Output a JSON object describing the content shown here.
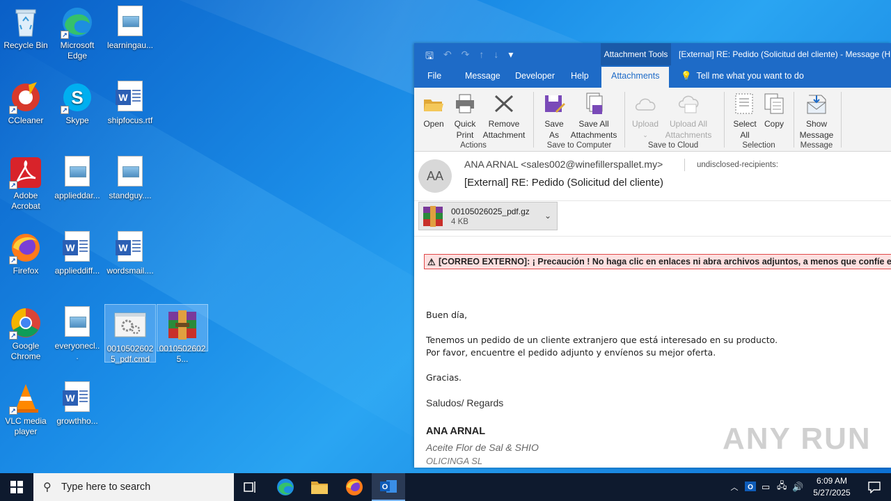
{
  "desktop": {
    "icons": [
      {
        "label": "Recycle Bin"
      },
      {
        "label": "Microsoft Edge"
      },
      {
        "label": "learningau..."
      },
      {
        "label": "CCleaner"
      },
      {
        "label": "Skype"
      },
      {
        "label": "shipfocus.rtf"
      },
      {
        "label": "Adobe Acrobat"
      },
      {
        "label": "applieddar..."
      },
      {
        "label": "standguy...."
      },
      {
        "label": "Firefox"
      },
      {
        "label": "applieddiff..."
      },
      {
        "label": "wordsmail...."
      },
      {
        "label": "Google Chrome"
      },
      {
        "label": "everyonecl..."
      },
      {
        "label": "00105026025_pdf.cmd"
      },
      {
        "label": "00105026025..."
      },
      {
        "label": "VLC media player"
      },
      {
        "label": "growthho..."
      }
    ],
    "watermark": "ANY RUN"
  },
  "outlook": {
    "context_tab": "Attachment Tools",
    "title": "[External] RE: Pedido  (Solicitud del cliente)  -  Message (H",
    "tabs": {
      "file": "File",
      "message": "Message",
      "developer": "Developer",
      "help": "Help",
      "attachments": "Attachments"
    },
    "tell_me": "Tell me what you want to do",
    "ribbon": {
      "open": "Open",
      "quick_print_1": "Quick",
      "quick_print_2": "Print",
      "remove_1": "Remove",
      "remove_2": "Attachment",
      "actions_group": "Actions",
      "save_as_1": "Save",
      "save_as_2": "As",
      "save_all_1": "Save All",
      "save_all_2": "Attachments",
      "save_computer_group": "Save to Computer",
      "upload": "Upload",
      "upload_all_1": "Upload All",
      "upload_all_2": "Attachments",
      "save_cloud_group": "Save to Cloud",
      "select_all_1": "Select",
      "select_all_2": "All",
      "copy": "Copy",
      "selection_group": "Selection",
      "show_message_1": "Show",
      "show_message_2": "Message",
      "message_group": "Message"
    },
    "email": {
      "avatar_initials": "AA",
      "from": "ANA ARNAL <sales002@winefillerspallet.my>",
      "to": "undisclosed-recipients:",
      "subject": "[External] RE: Pedido  (Solicitud del cliente)",
      "attachment_name": "00105026025_pdf.gz",
      "attachment_size": "4 KB",
      "banner": "[CORREO EXTERNO]: ¡ Precaución ! No haga clic en enlaces ni abra archivos adjuntos, a menos que confíe en el",
      "greeting": "Buen día,",
      "line1": "Tenemos un pedido de un cliente extranjero que está interesado en su producto.",
      "line2": "Por favor, encuentre el pedido adjunto y envíenos su mejor oferta.",
      "thanks": "Gracias.",
      "regards": "Saludos/ Regards",
      "sig_name": "ANA ARNAL",
      "sig_company": "Aceite Flor de Sal & SHIO",
      "sig_company2": "OLICINGA SL"
    }
  },
  "taskbar": {
    "search_placeholder": "Type here to search",
    "time": "6:09 AM",
    "date": "5/27/2025"
  }
}
